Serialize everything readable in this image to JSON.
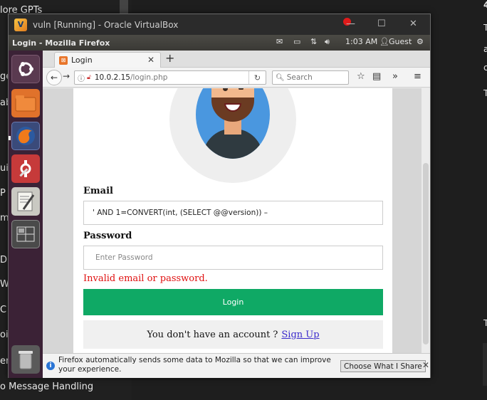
{
  "background": {
    "left_lines": [
      "lore GPTs",
      "ge",
      "ab",
      "ui",
      "P",
      "ma",
      "D",
      "Wi",
      "C",
      "oit",
      "er",
      "o Message Handling"
    ],
    "right_lines": [
      "4",
      "T",
      "a",
      "c",
      "T",
      "T"
    ]
  },
  "vbox": {
    "title": "vuln [Running] - Oracle VirtualBox",
    "minimize": "☐",
    "maximize": "☐",
    "close": "✕"
  },
  "ubuntu_panel": {
    "app_name": "Login - Mozilla Firefox",
    "time": "1:03 AM",
    "user": "Guest"
  },
  "launcher": {
    "items": [
      "ubuntu-dash",
      "files",
      "firefox",
      "system-settings",
      "text-editor",
      "workspace-switcher",
      "trash"
    ]
  },
  "firefox": {
    "tab_label": "Login",
    "url_host": "10.0.2.15",
    "url_path": "/login.php",
    "search_placeholder": "Search"
  },
  "form": {
    "email_label": "Email",
    "email_value": "' AND 1=CONVERT(int, (SELECT @@version)) –",
    "password_label": "Password",
    "password_placeholder": "Enter Password",
    "error": "Invalid email or password.",
    "login_button": "Login",
    "signup_text": "You don't have an account ?",
    "signup_link": "Sign Up"
  },
  "notification": {
    "text": "Firefox automatically sends some data to Mozilla so that we can improve your experience.",
    "button": "Choose What I Share"
  }
}
